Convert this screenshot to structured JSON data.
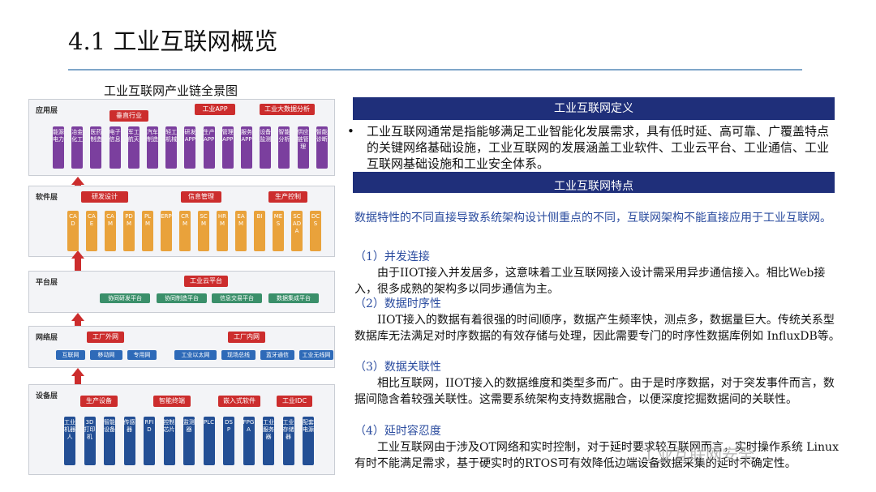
{
  "title": "4.1 工业互联网概览",
  "diagram_title": "工业互联网产业链全景图",
  "diagram": {
    "layers": [
      {
        "label": "应用层"
      },
      {
        "label": "软件层"
      },
      {
        "label": "平台层"
      },
      {
        "label": "网络层"
      },
      {
        "label": "设备层"
      }
    ],
    "app_headers": [
      "垂直行业",
      "工业APP",
      "工业大数据分析"
    ],
    "app_items": [
      "能源电力",
      "冶金化工",
      "医药制造",
      "电子信息",
      "军工航天",
      "汽车制造",
      "轻工机械",
      "研发APP",
      "生产APP",
      "管理APP",
      "服务APP",
      "设备监测",
      "智能分析",
      "供应链管理",
      "智能诊断"
    ],
    "software_headers": [
      "研发设计",
      "信息管理",
      "生产控制"
    ],
    "software_items": [
      "CAD",
      "CAE",
      "CAM",
      "PDM",
      "PLM",
      "ERP",
      "CRM",
      "SCM",
      "HRM",
      "EAM",
      "BI",
      "MES",
      "SCADA",
      "DCS"
    ],
    "platform_header": "工业云平台",
    "platform_items": [
      "协同研发平台",
      "协同制造平台",
      "信息交易平台",
      "数据集成平台"
    ],
    "network_headers": [
      "工厂外网",
      "工厂内网"
    ],
    "network_items": [
      "互联网",
      "移动网",
      "专用网",
      "工业以太网",
      "现场总线",
      "蓝牙通信",
      "工业无线网"
    ],
    "device_headers": [
      "生产设备",
      "智能终端",
      "嵌入式软件",
      "工业IDC"
    ],
    "device_items": [
      "工业机器人",
      "3D打印机",
      "智能设备",
      "传感器",
      "RFID",
      "控制芯片",
      "监测器",
      "PLC",
      "DSP",
      "FPGA",
      "工业服务器",
      "工业存储器",
      "配套电源"
    ]
  },
  "definition": {
    "band_title": "工业互联网定义",
    "bullet_dot": "•",
    "text": "工业互联网通常是指能够满足工业智能化发展需求，具有低时延、高可靠、广覆盖特点的关键网络基础设施，工业互联网的发展涵盖工业软件、工业云平台、工业通信、工业互联网基础设施和工业安全体系。"
  },
  "features": {
    "band_title": "工业互联网特点",
    "lead": "数据特性的不同直接导致系统架构设计侧重点的不同，互联网架构不能直接应用于工业互联网。",
    "items": [
      {
        "heading": "（1）并发连接",
        "body": "由于IIOT接入并发居多，这意味着工业互联网接入设计需采用异步通信接入。相比Web接入，很多成熟的架构多以同步通信为主。"
      },
      {
        "heading": "（2）数据时序性",
        "body": "IIOT接入的数据有着很强的时间顺序，数据产生频率快，测点多，数据量巨大。传统关系型数据库无法满足对时序数据的有效存储与处理，因此需要专门的时序性数据库例如 InfluxDB等。"
      },
      {
        "heading": "（3）数据关联性",
        "body": "相比互联网，IIOT接入的数据维度和类型多而广。由于是时序数据，对于突发事件而言，数据间隐含着较强关联性。这需要系统架构支持数据融合，以便深度挖掘数据间的关联性。"
      },
      {
        "heading": "（4）延时容忍度",
        "body": "工业互联网由于涉及OT网络和实时控制，对于延时要求较互联网而言，实时操作系统 Linux有时不能满足需求，基于硬实时的RTOS可有效降低边端设备数据采集的延时不确定性。"
      }
    ]
  },
  "watermark": "工业互联网安全"
}
